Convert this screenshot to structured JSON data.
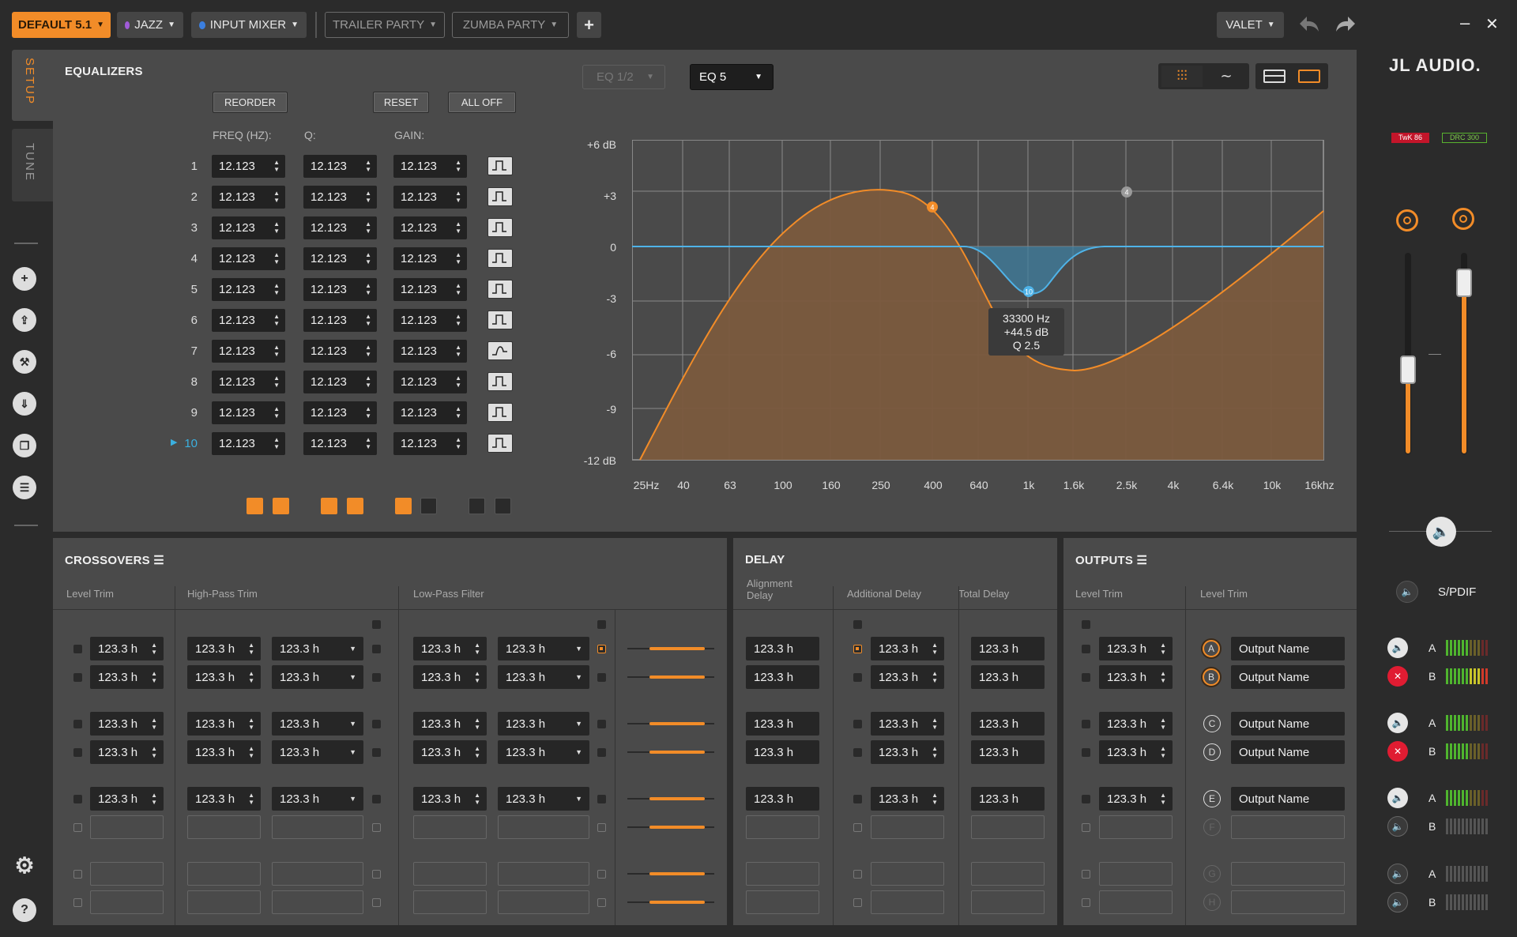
{
  "topbar": {
    "preset": "DEFAULT 5.1",
    "genre": "JAZZ",
    "mixer": "INPUT MIXER",
    "party1": "TRAILER PARTY",
    "party2": "ZUMBA PARTY",
    "add": "+",
    "valet": "VALET",
    "minimize": "–",
    "close": "✕",
    "colors": {
      "accent": "#f28c28",
      "genre_dot": "#a05bd8",
      "mixer_dot": "#3b7fe0"
    }
  },
  "left_tabs": {
    "setup": "SETUP",
    "tune": "TUNE"
  },
  "sidebar_icons": [
    "add-icon",
    "upload-icon",
    "wrench-icon",
    "download-icon",
    "copy-icon",
    "list-icon",
    "settings-icon",
    "help-icon"
  ],
  "eq": {
    "title": "EQUALIZERS",
    "reorder": "REORDER",
    "reset": "RESET",
    "all_off": "ALL OFF",
    "col_freq": "FREQ (HZ):",
    "col_q": "Q:",
    "col_gain": "GAIN:",
    "eq_half": "EQ 1/2",
    "eq_sel": "EQ 5",
    "rows": [
      {
        "n": "1",
        "freq": "12.123",
        "q": "12.123",
        "gain": "12.123"
      },
      {
        "n": "2",
        "freq": "12.123",
        "q": "12.123",
        "gain": "12.123"
      },
      {
        "n": "3",
        "freq": "12.123",
        "q": "12.123",
        "gain": "12.123"
      },
      {
        "n": "4",
        "freq": "12.123",
        "q": "12.123",
        "gain": "12.123"
      },
      {
        "n": "5",
        "freq": "12.123",
        "q": "12.123",
        "gain": "12.123"
      },
      {
        "n": "6",
        "freq": "12.123",
        "q": "12.123",
        "gain": "12.123"
      },
      {
        "n": "7",
        "freq": "12.123",
        "q": "12.123",
        "gain": "12.123"
      },
      {
        "n": "8",
        "freq": "12.123",
        "q": "12.123",
        "gain": "12.123"
      },
      {
        "n": "9",
        "freq": "12.123",
        "q": "12.123",
        "gain": "12.123"
      },
      {
        "n": "10",
        "freq": "12.123",
        "q": "12.123",
        "gain": "12.123"
      }
    ],
    "active_row": "10",
    "bank_states": [
      "on",
      "on",
      "on",
      "on",
      "on",
      "off",
      "off",
      "off"
    ]
  },
  "graph": {
    "y_labels": [
      "+6 dB",
      "+3",
      "0",
      "-3",
      "-6",
      "-9",
      "-12 dB"
    ],
    "x_labels": [
      "25Hz",
      "40",
      "63",
      "100",
      "160",
      "250",
      "400",
      "640",
      "1k",
      "1.6k",
      "2.5k",
      "4k",
      "6.4k",
      "10k",
      "16khz"
    ],
    "markers": {
      "orange": "4",
      "gray": "4",
      "blue": "10"
    },
    "tooltip": {
      "freq": "33300 Hz",
      "gain": "+44.5 dB",
      "q": "Q 2.5"
    }
  },
  "crossovers": {
    "title": "CROSSOVERS",
    "level_trim": "Level Trim",
    "hp_trim": "High-Pass Trim",
    "lp_filter": "Low-Pass Filter",
    "value": "123.3 h"
  },
  "delay": {
    "title": "DELAY",
    "alignment": "Alignment Delay",
    "additional": "Additional Delay",
    "total": "Total Delay",
    "value": "123.3 h"
  },
  "outputs": {
    "title": "OUTPUTS",
    "level_trim": "Level Trim",
    "level_trim2": "Level Trim",
    "value": "123.3 h",
    "channels": [
      {
        "letter": "A",
        "name": "Output Name"
      },
      {
        "letter": "B",
        "name": "Output Name"
      },
      {
        "letter": "C",
        "name": "Output Name"
      },
      {
        "letter": "D",
        "name": "Output Name"
      },
      {
        "letter": "E",
        "name": "Output Name"
      },
      {
        "letter": "F",
        "name": ""
      },
      {
        "letter": "G",
        "name": ""
      },
      {
        "letter": "H",
        "name": ""
      }
    ]
  },
  "right": {
    "brand": "JL AUDIO.",
    "badge1": "TwK 86",
    "badge2": "DRC 300",
    "spdif": "S/PDIF",
    "slider1_level": 0.42,
    "slider2_level": 0.85,
    "meters": [
      {
        "label": "A",
        "muted": false
      },
      {
        "label": "B",
        "muted": true
      },
      {
        "label": "A",
        "muted": false
      },
      {
        "label": "B",
        "muted": true
      },
      {
        "label": "A",
        "muted": false
      },
      {
        "label": "B",
        "muted": false
      },
      {
        "label": "A",
        "muted": false
      },
      {
        "label": "B",
        "muted": false
      }
    ]
  }
}
